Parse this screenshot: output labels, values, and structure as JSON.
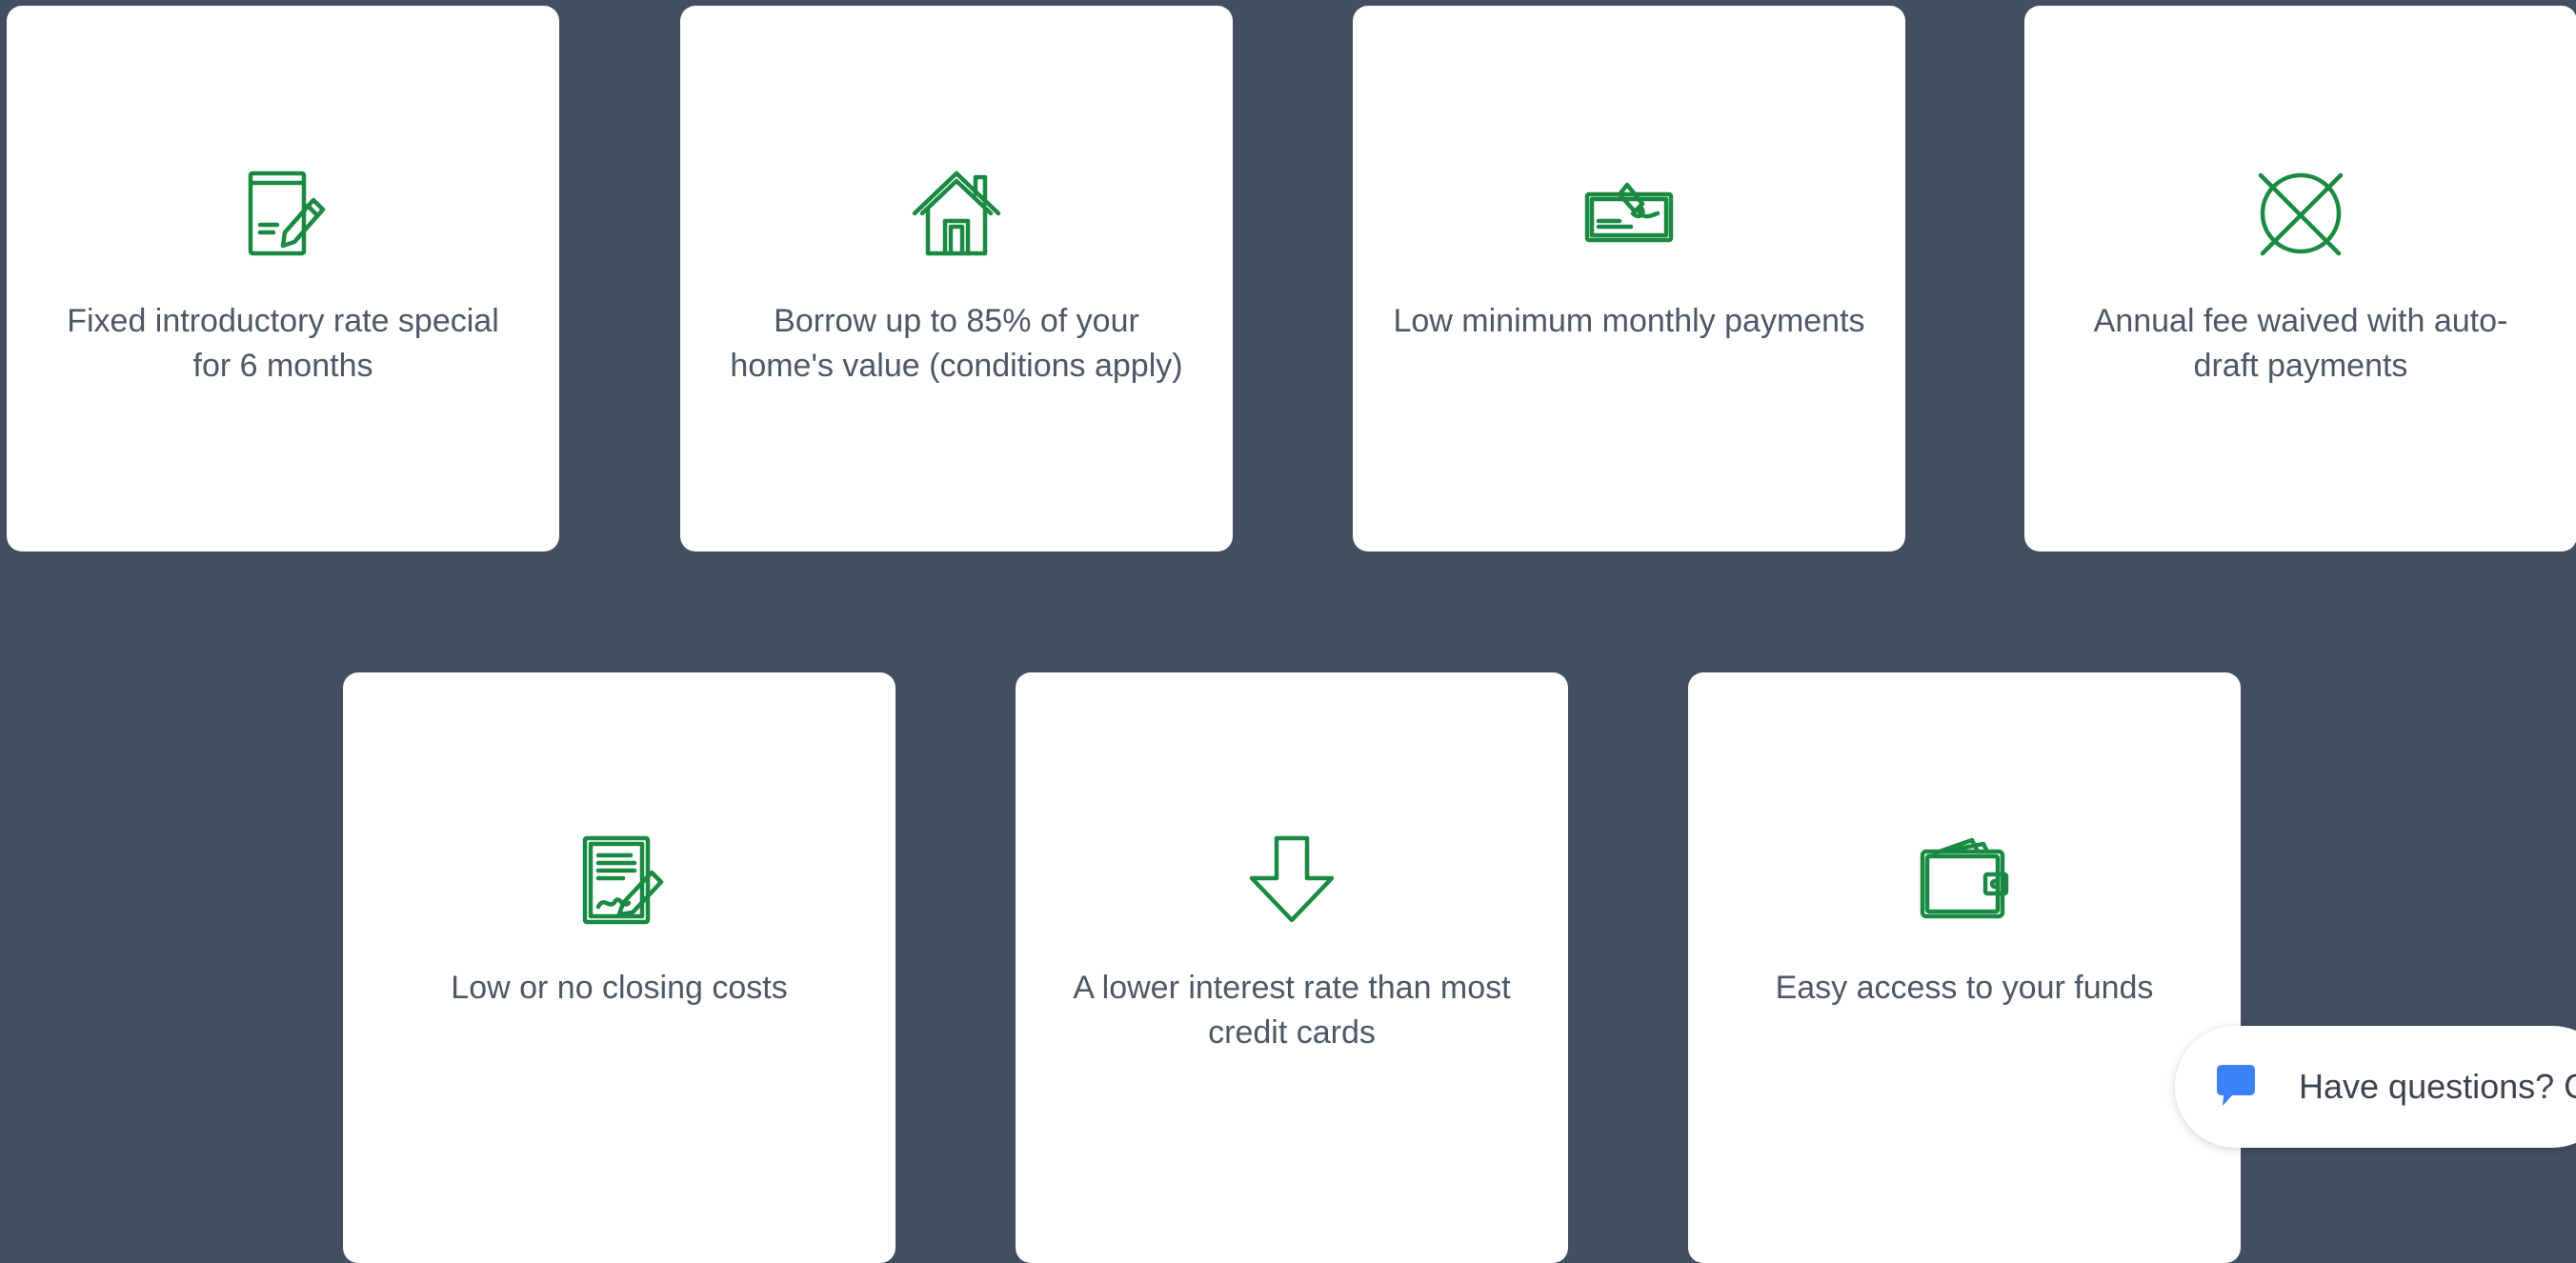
{
  "colors": {
    "background": "#434f61",
    "card": "#ffffff",
    "icon_green": "#1a8a43",
    "text": "#4c5768",
    "chat_icon": "#3b82f6"
  },
  "features": [
    {
      "icon": "document-pencil-icon",
      "label": "Fixed introductory rate special for 6 months"
    },
    {
      "icon": "house-icon",
      "label": "Borrow up to 85% of your home's value (conditions apply)"
    },
    {
      "icon": "check-signature-icon",
      "label": "Low minimum monthly payments"
    },
    {
      "icon": "circle-x-icon",
      "label": "Annual fee waived with auto-draft payments"
    },
    {
      "icon": "signed-document-icon",
      "label": "Low or no closing costs"
    },
    {
      "icon": "down-arrow-icon",
      "label": "A lower interest rate than most credit cards"
    },
    {
      "icon": "wallet-icon",
      "label": "Easy access to your funds"
    }
  ],
  "chat": {
    "icon": "chat-bubble-icon",
    "text": "Have questions? C"
  }
}
